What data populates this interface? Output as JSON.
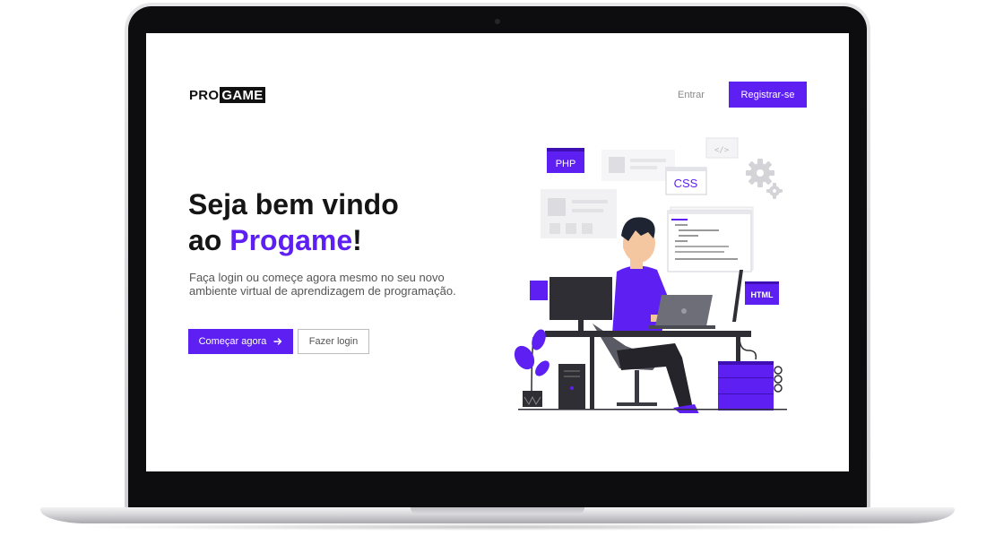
{
  "header": {
    "logo_part1": "PRO",
    "logo_part2": "GAME",
    "login_label": "Entrar",
    "register_label": "Registrar-se"
  },
  "hero": {
    "headline_line1": "Seja bem vindo",
    "headline_prefix": "ao ",
    "headline_brand": "Progame",
    "headline_suffix": "!",
    "description": "Faça login ou começe agora mesmo no seu novo ambiente virtual de aprendizagem de programação.",
    "primary_button": "Começar agora",
    "secondary_button": "Fazer login"
  },
  "illustration": {
    "tag_php": "PHP",
    "tag_css": "CSS",
    "tag_html": "HTML",
    "tag_code": "</>"
  },
  "colors": {
    "accent": "#5d1ff2",
    "text_dark": "#151515",
    "text_muted": "#8a8a8a"
  },
  "icons": {
    "primary_button_icon": "arrow-right-icon",
    "decor": [
      "gear-icon",
      "plant-icon",
      "laptop-icon",
      "monitor-icon"
    ]
  }
}
